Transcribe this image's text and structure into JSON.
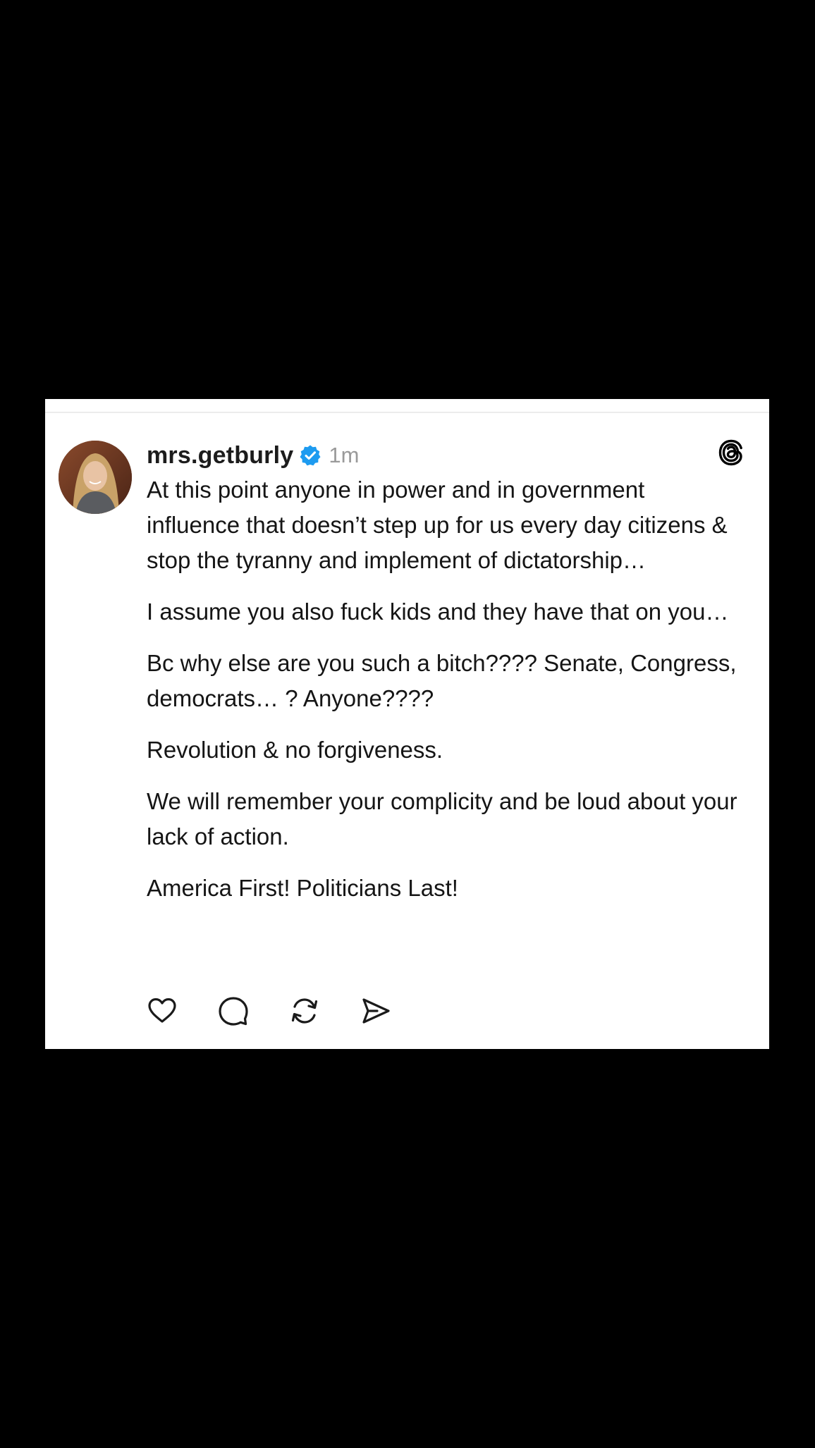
{
  "post": {
    "username": "mrs.getburly",
    "verified": true,
    "timestamp": "1m",
    "paragraphs": [
      "At this point anyone in power and in government influence that doesn’t step up for us every day citizens & stop the tyranny and implement of dictatorship…",
      "I assume you also fuck kids and they have that on you…",
      "Bc why else are you such a bitch???? Senate, Congress, democrats… ? Anyone????",
      "Revolution & no forgiveness.",
      "We will remember your complicity and be loud about your lack of action.",
      "America First! Politicians Last!"
    ]
  },
  "icons": {
    "avatar": "user-profile-photo",
    "verified": "verified-badge-icon",
    "brand": "threads-logo-icon",
    "actions": [
      "heart-icon",
      "comment-icon",
      "repost-icon",
      "share-icon"
    ]
  },
  "colors": {
    "background": "#000000",
    "card": "#ffffff",
    "verified": "#1d9bf0",
    "text": "#151515",
    "muted": "#9a9a9a"
  }
}
